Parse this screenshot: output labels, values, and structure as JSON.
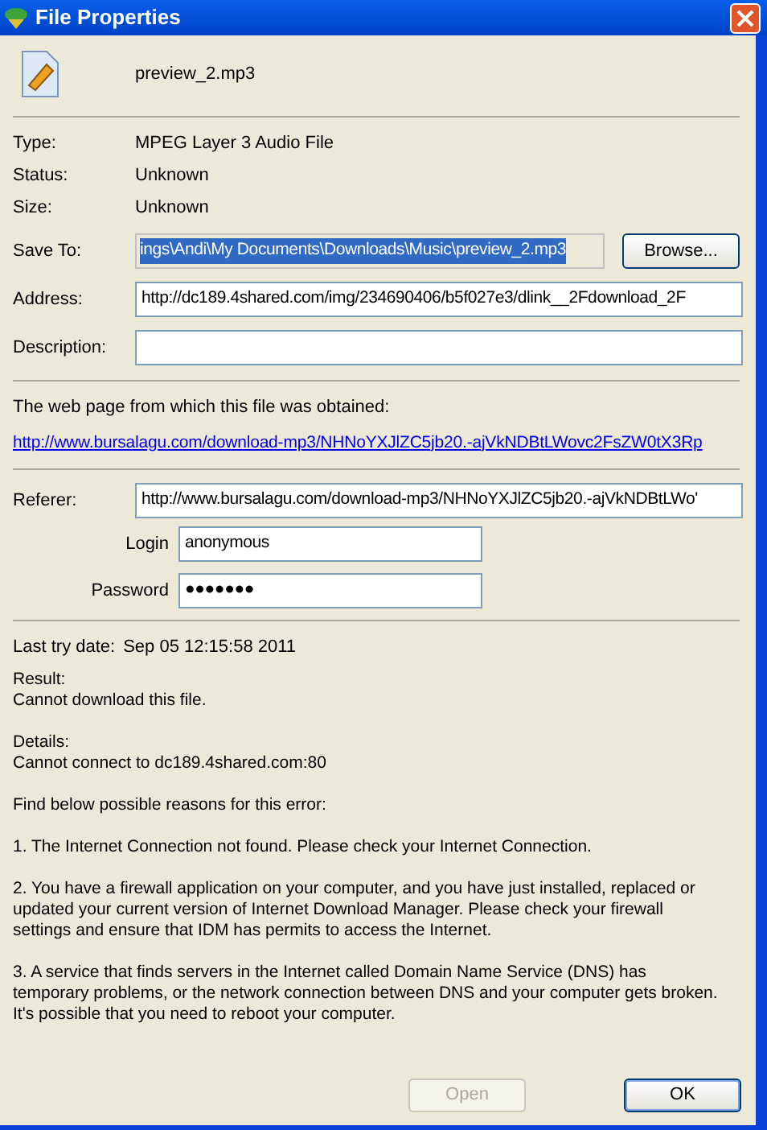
{
  "window": {
    "title": "File Properties"
  },
  "file": {
    "name": "preview_2.mp3"
  },
  "properties": [
    {
      "label": "Type:",
      "value": "MPEG Layer 3 Audio File"
    },
    {
      "label": "Status:",
      "value": "Unknown"
    },
    {
      "label": "Size:",
      "value": "Unknown"
    }
  ],
  "save_to": {
    "label": "Save To:",
    "value": "ings\\Andi\\My Documents\\Downloads\\Music\\preview_2.mp3",
    "selected": true
  },
  "browse_button": "Browse...",
  "address": {
    "label": "Address:",
    "value": "http://dc189.4shared.com/img/234690406/b5f027e3/dlink__2Fdownload_2F"
  },
  "description": {
    "label": "Description:"
  },
  "source": {
    "text": "The web page from which this file was obtained:",
    "link": "http://www.bursalagu.com/download-mp3/NHNoYXJlZC5jb20.-ajVkNDBtLWovc2FsZW0tX3Rp"
  },
  "referer": {
    "label": "Referer:",
    "value": "http://www.bursalagu.com/download-mp3/NHNoYXJlZC5jb20.-ajVkNDBtLWo'"
  },
  "login": {
    "label": "Login",
    "value": "anonymous"
  },
  "password": {
    "label": "Password",
    "value": "●●●●●●●"
  },
  "last_try": {
    "label": "Last try date:",
    "value": "Sep 05 12:15:58 2011"
  },
  "messages": [
    {
      "lines": [
        "Result:",
        "Cannot download this file."
      ]
    },
    {
      "lines": [
        "Details:",
        "Cannot connect to dc189.4shared.com:80"
      ]
    },
    {
      "lines": [
        "Find below possible reasons for this error:"
      ]
    },
    {
      "lines": [
        "1. The Internet Connection not found. Please check your Internet Connection."
      ]
    },
    {
      "lines": [
        "2. You have a firewall application on your computer, and you have just installed, replaced or",
        "updated your current version of Internet Download Manager. Please check your firewall",
        "settings and ensure that IDM has permits to access the Internet."
      ]
    },
    {
      "lines": [
        "3. A service that finds servers in the Internet called Domain Name Service (DNS) has",
        "temporary problems, or the network connection between DNS and your computer gets broken.",
        "It's possible that you need to reboot your computer."
      ]
    }
  ],
  "buttons": [
    {
      "label": "Open",
      "disabled": true
    },
    {
      "label": "OK",
      "disabled": false
    }
  ]
}
